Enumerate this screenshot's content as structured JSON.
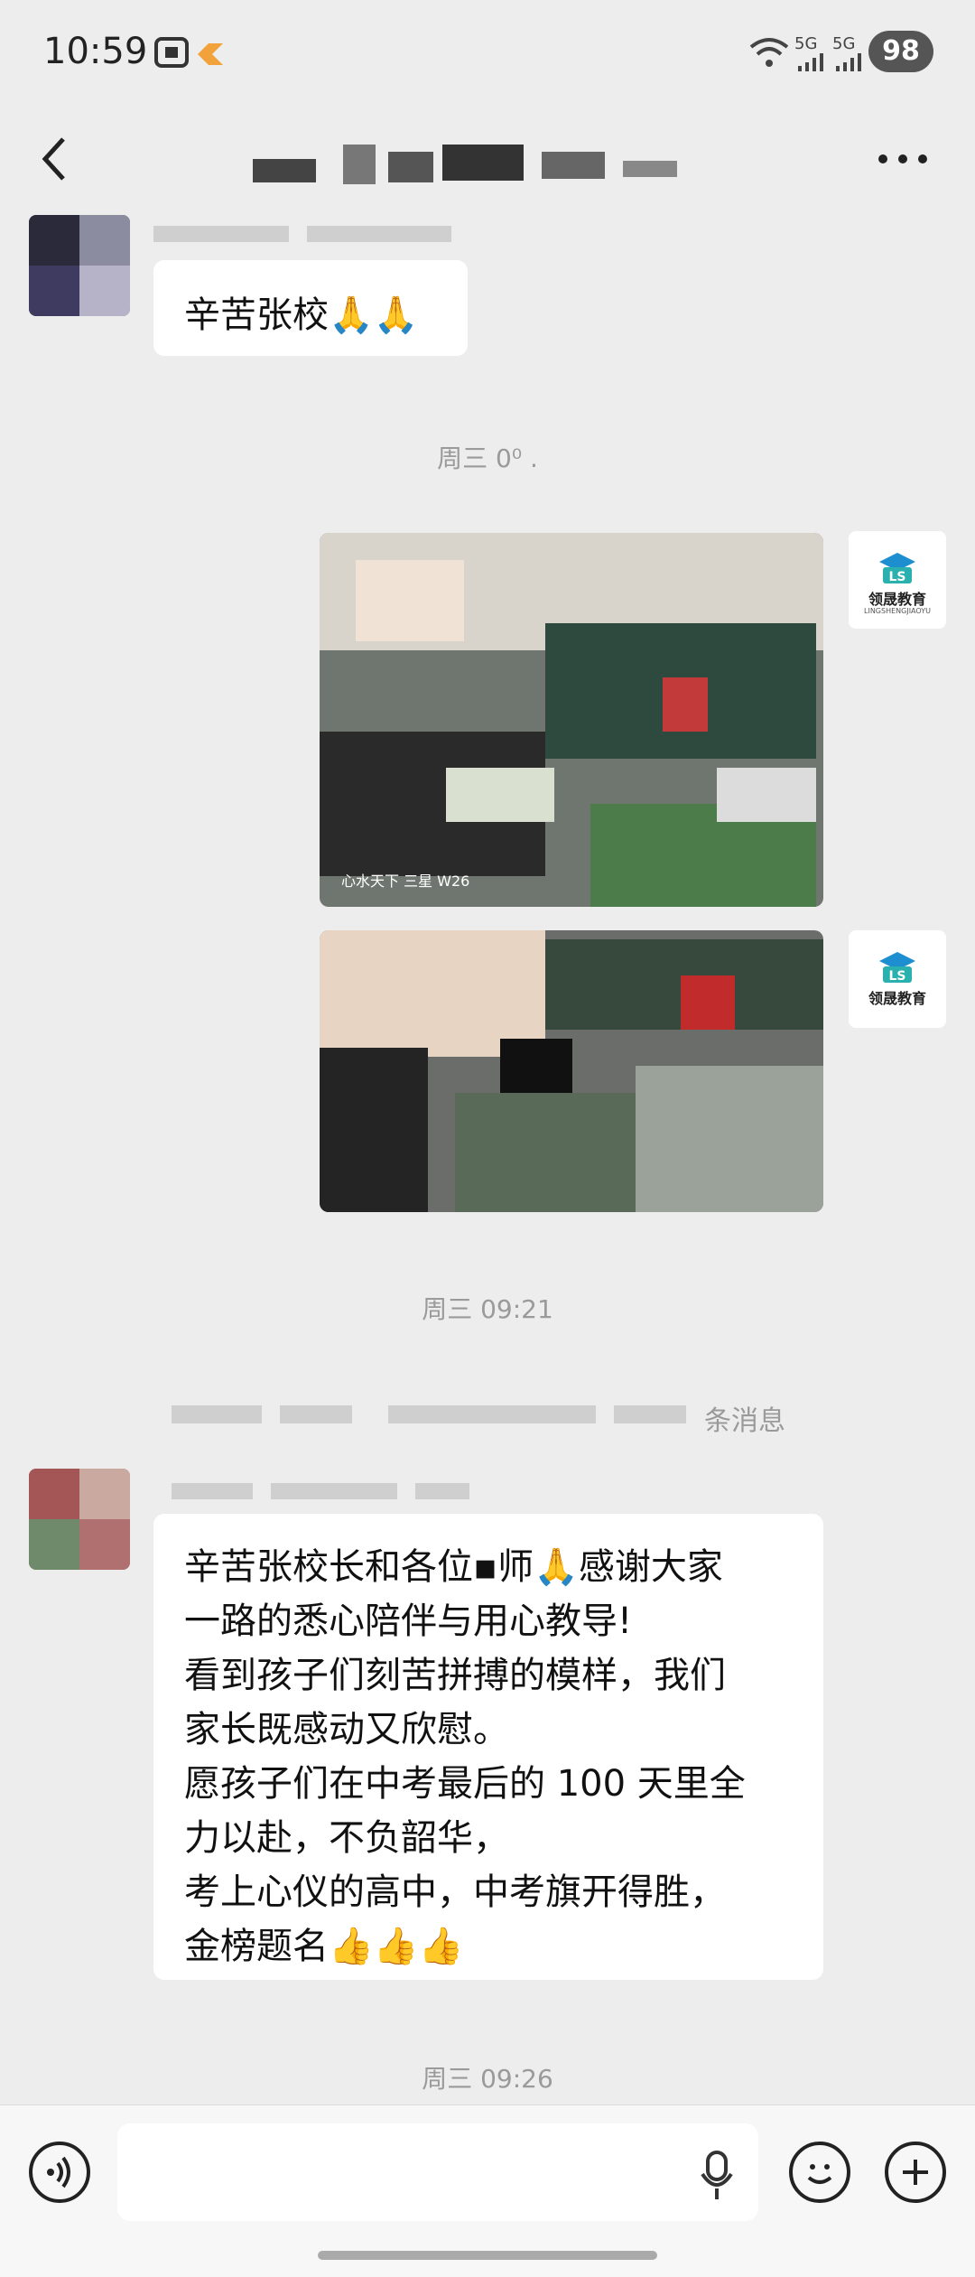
{
  "status_bar": {
    "time": "10:59",
    "signal_1": "5G",
    "signal_2": "5G",
    "battery": "98"
  },
  "header": {
    "back_icon": "chevron-left-icon",
    "more_icon": "more-horizontal-icon"
  },
  "messages": [
    {
      "type": "text",
      "side": "left",
      "text": "辛苦张校🙏🙏"
    },
    {
      "type": "timestamp",
      "text": "周三 0⁰ ."
    },
    {
      "type": "image",
      "side": "right",
      "caption": "心水天下 三星 W26"
    },
    {
      "type": "image",
      "side": "right"
    },
    {
      "type": "timestamp",
      "text": "周三 09:21"
    },
    {
      "type": "system",
      "text": "条消息"
    },
    {
      "type": "text",
      "side": "left",
      "lines": [
        "辛苦张校长和各位▪师🙏感谢大家",
        "一路的悉心陪伴与用心教导!",
        "看到孩子们刻苦拼搏的模样，我们",
        "家长既感动又欣慰。",
        "愿孩子们在中考最后的 100 天里全",
        "力以赴，不负韶华，",
        "考上心仪的高中，中考旗开得胜，",
        "金榜题名👍👍👍"
      ]
    },
    {
      "type": "timestamp",
      "text": "周三 09:26"
    }
  ],
  "avatar_right": {
    "brand": "领晟教育",
    "brand_sub": "LINGSHENGJIAOYU",
    "color": "#1d8fd1"
  },
  "input": {
    "voice_icon": "voice-icon",
    "mic_icon": "microphone-icon",
    "emoji_icon": "emoji-icon",
    "plus_icon": "plus-icon"
  }
}
